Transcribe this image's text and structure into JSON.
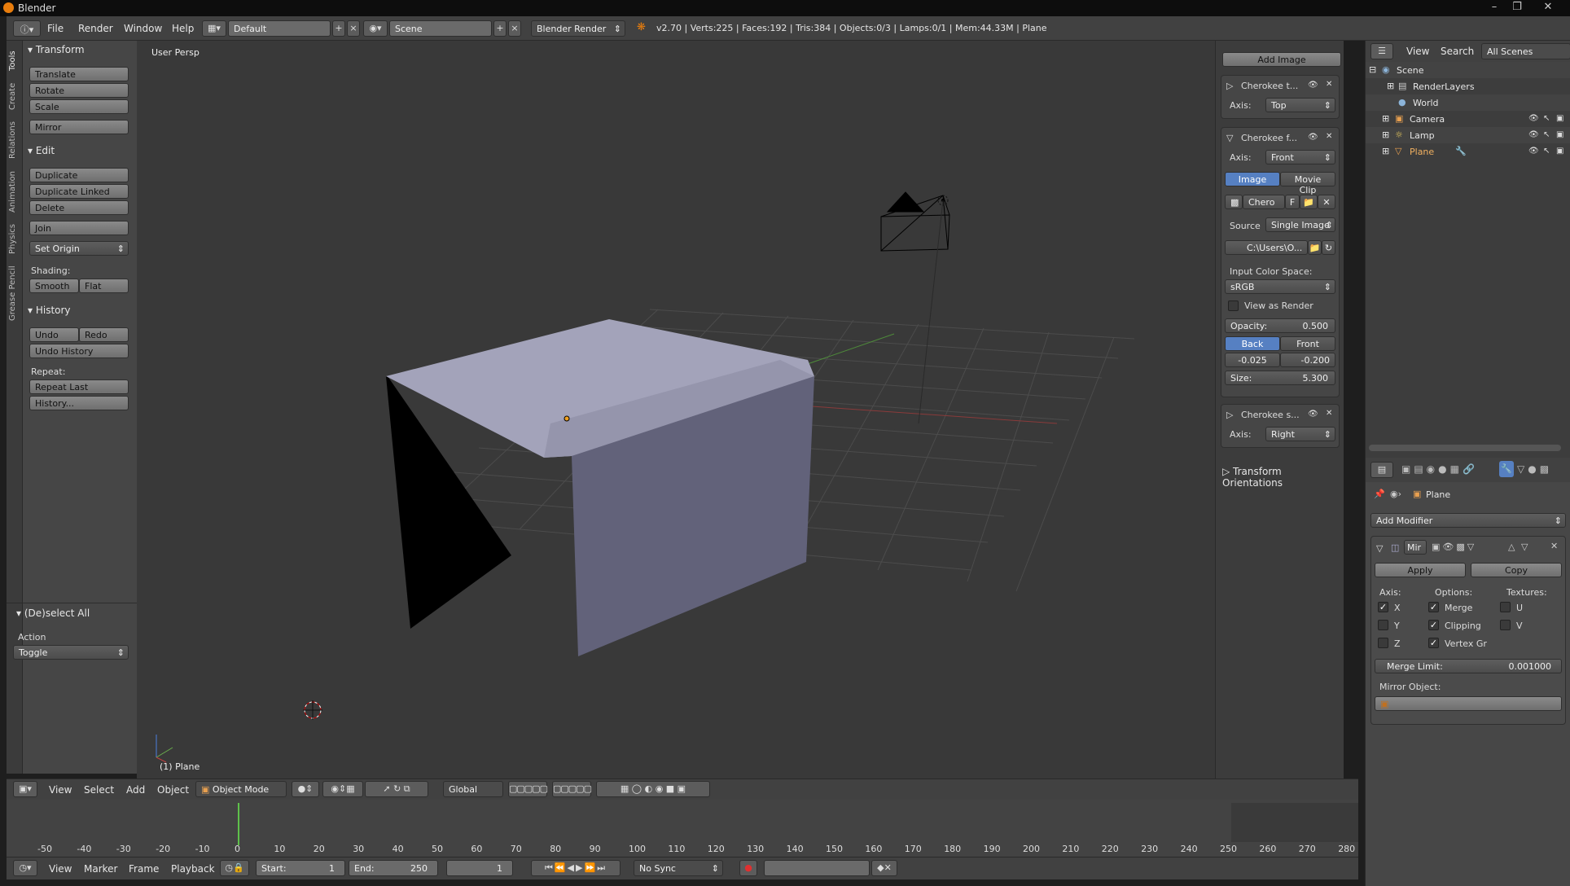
{
  "window": {
    "title": "Blender"
  },
  "info_header": {
    "menus": [
      "File",
      "Render",
      "Window",
      "Help"
    ],
    "layout": "Default",
    "scene": "Scene",
    "engine": "Blender Render",
    "stats": "v2.70 | Verts:225 | Faces:192 | Tris:384 | Objects:0/3 | Lamps:0/1 | Mem:44.33M | Plane"
  },
  "tabs": [
    "Tools",
    "Create",
    "Relations",
    "Animation",
    "Physics",
    "Grease Pencil"
  ],
  "tool_shelf": {
    "transform": {
      "title": "Transform",
      "buttons": [
        "Translate",
        "Rotate",
        "Scale",
        "Mirror"
      ]
    },
    "edit": {
      "title": "Edit",
      "buttons": [
        "Duplicate",
        "Duplicate Linked",
        "Delete",
        "Join"
      ],
      "set_origin": "Set Origin",
      "shading_label": "Shading:",
      "smooth": "Smooth",
      "flat": "Flat"
    },
    "history": {
      "title": "History",
      "undo": "Undo",
      "redo": "Redo",
      "undo_history": "Undo History",
      "repeat_label": "Repeat:",
      "repeat_last": "Repeat Last",
      "history_btn": "History..."
    },
    "operator": {
      "title": "(De)select All",
      "action_label": "Action",
      "action_value": "Toggle"
    }
  },
  "viewport": {
    "view_label": "User Persp",
    "object_label": "(1) Plane"
  },
  "viewport_header": {
    "menus": [
      "View",
      "Select",
      "Add",
      "Object"
    ],
    "mode": "Object Mode",
    "orientation": "Global"
  },
  "n_panel": {
    "add_image": "Add Image",
    "bg1": {
      "name": "Cherokee t...",
      "axis_label": "Axis:",
      "axis": "Top"
    },
    "bg2": {
      "name": "Cherokee f...",
      "axis_label": "Axis:",
      "axis": "Front",
      "tab_image": "Image",
      "tab_movie": "Movie Clip",
      "image_name": "Chero",
      "f_label": "F",
      "source_label": "Source",
      "source": "Single Image",
      "path": "C:\\Users\\O...",
      "color_space_label": "Input Color Space:",
      "color_space": "sRGB",
      "view_as_render": "View as Render",
      "opacity_label": "Opacity:",
      "opacity": "0.500",
      "back": "Back",
      "front": "Front",
      "offset_x": "-0.025",
      "offset_y": "-0.200",
      "size_label": "Size:",
      "size": "5.300"
    },
    "bg3": {
      "name": "Cherokee s...",
      "axis_label": "Axis:",
      "axis": "Right"
    },
    "transform_orientations": "Transform Orientations"
  },
  "outliner": {
    "header_menus": [
      "View",
      "Search"
    ],
    "filter": "All Scenes",
    "rows": [
      "Scene",
      "RenderLayers",
      "World",
      "Camera",
      "Lamp",
      "Plane"
    ]
  },
  "properties": {
    "object_name": "Plane",
    "add_modifier": "Add Modifier",
    "modifier_name": "Mir",
    "apply": "Apply",
    "copy": "Copy",
    "axis_label": "Axis:",
    "options_label": "Options:",
    "textures_label": "Textures:",
    "axis": [
      "X",
      "Y",
      "Z"
    ],
    "options": [
      "Merge",
      "Clipping",
      "Vertex Gr"
    ],
    "textures": [
      "U",
      "V"
    ],
    "merge_limit_label": "Merge Limit:",
    "merge_limit": "0.001000",
    "mirror_object_label": "Mirror Object:"
  },
  "timeline": {
    "ticks": [
      "-50",
      "-40",
      "-30",
      "-20",
      "-10",
      "0",
      "10",
      "20",
      "30",
      "40",
      "50",
      "60",
      "70",
      "80",
      "90",
      "100",
      "110",
      "120",
      "130",
      "140",
      "150",
      "160",
      "170",
      "180",
      "190",
      "200",
      "210",
      "220",
      "230",
      "240",
      "250",
      "260",
      "270",
      "280"
    ],
    "menus": [
      "View",
      "Marker",
      "Frame",
      "Playback"
    ],
    "start_label": "Start:",
    "start": "1",
    "end_label": "End:",
    "end": "250",
    "current": "1",
    "sync": "No Sync"
  }
}
